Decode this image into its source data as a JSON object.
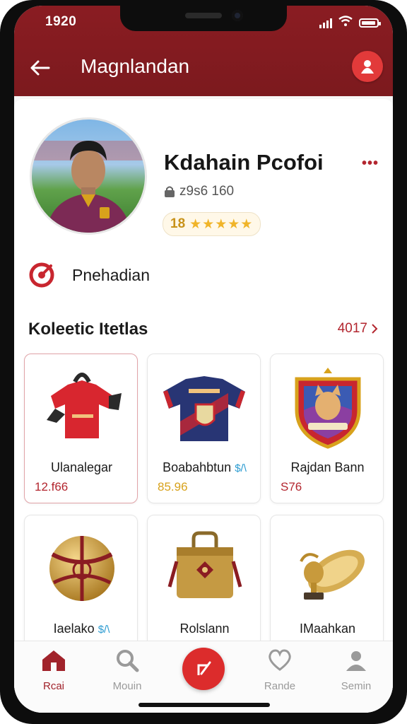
{
  "status": {
    "time": "1920"
  },
  "header": {
    "title": "Magnlandan"
  },
  "profile": {
    "name": "Kdahain Pcofoi",
    "id_text": "z9s6 160",
    "rating_value": "18",
    "rating_stars": "★★★★★",
    "more": "•••"
  },
  "prediction": {
    "label": "Pnehadian"
  },
  "collection": {
    "title": "Koleetic Itetlas",
    "see_all": "4017",
    "items": [
      {
        "name": "Ulanalegar",
        "tag": "",
        "price": "12.f66",
        "price_color": "#b3262f",
        "icon": "red-jersey-icon"
      },
      {
        "name": "Boabahbtun",
        "tag": "$/\\",
        "price": "85.96",
        "price_color": "#d8a21c",
        "icon": "navy-jersey-icon"
      },
      {
        "name": "Rajdan Bann",
        "tag": "",
        "price": "S76",
        "price_color": "#b3262f",
        "icon": "crest-badge-icon"
      },
      {
        "name": "Iaelako",
        "tag": "$/\\",
        "price": "",
        "price_color": "#b3262f",
        "icon": "golden-ball-icon"
      },
      {
        "name": "Rolslann",
        "tag": "",
        "price": "",
        "price_color": "#b3262f",
        "icon": "golden-bag-icon"
      },
      {
        "name": "IMaahkan",
        "tag": "",
        "price": "",
        "price_color": "#b3262f",
        "icon": "golden-trophy-icon"
      }
    ]
  },
  "nav": {
    "items": [
      {
        "label": "Rcai",
        "icon": "home-icon"
      },
      {
        "label": "Mouin",
        "icon": "search-icon"
      },
      {
        "label": "",
        "icon": "edit-icon"
      },
      {
        "label": "Rande",
        "icon": "heart-icon"
      },
      {
        "label": "Semin",
        "icon": "profile-icon"
      }
    ]
  },
  "colors": {
    "brand": "#8a1c22",
    "accent": "#dc2c2c",
    "gold": "#d8a21c"
  }
}
